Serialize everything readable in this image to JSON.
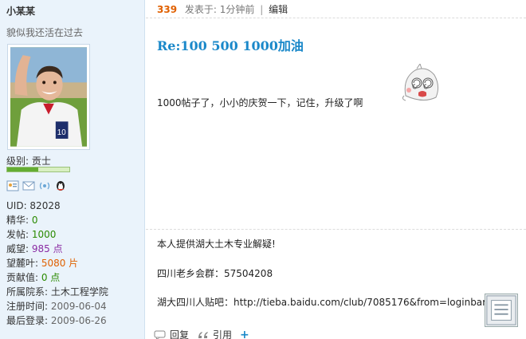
{
  "user": {
    "name": "小某某",
    "signature": "貌似我还活在过去",
    "rank_label": "级别: 贡士",
    "rank_progress": 0.5,
    "stats": [
      {
        "key": "UID: ",
        "value": "82028",
        "style": "dark"
      },
      {
        "key": "精华: ",
        "value": "0",
        "style": "green"
      },
      {
        "key": "发帖: ",
        "value": "1000",
        "style": "green"
      },
      {
        "key": "威望: ",
        "value": "985 点",
        "style": "purple"
      },
      {
        "key": "望麓叶: ",
        "value": "5080 片",
        "style": "orange"
      },
      {
        "key": "贡献值: ",
        "value": "0 点",
        "style": "green"
      },
      {
        "key": "所属院系: ",
        "value": "土木工程学院",
        "style": "dark"
      },
      {
        "key": "注册时间: ",
        "value": "2009-06-04",
        "style": "gray"
      },
      {
        "key": "最后登录: ",
        "value": "2009-06-26",
        "style": "gray"
      }
    ],
    "icons": [
      "profile-card-icon",
      "message-icon",
      "broadcast-icon",
      "qq-penguin-icon"
    ]
  },
  "post": {
    "floor": "339",
    "posted_label": "发表于: 1分钟前",
    "sep": "|",
    "edit_label": "编辑",
    "title": "Re:100 500  1000加油",
    "content": "1000帖子了，小小的庆贺一下，记住，升级了啊",
    "emoticon": "dizzy-face-emoticon",
    "signature_lines": [
      "本人提供湖大土木专业解疑!",
      "四川老乡会群：57504208",
      "湖大四川人贴吧：http://tieba.baidu.com/club/7085176&from=loginbar"
    ],
    "actions": {
      "reply": "回复",
      "quote": "引用",
      "plus": "+"
    }
  },
  "colors": {
    "accent": "#1a88c9",
    "floor": "#e06000",
    "sidebar_bg": "#eaf3fb"
  }
}
